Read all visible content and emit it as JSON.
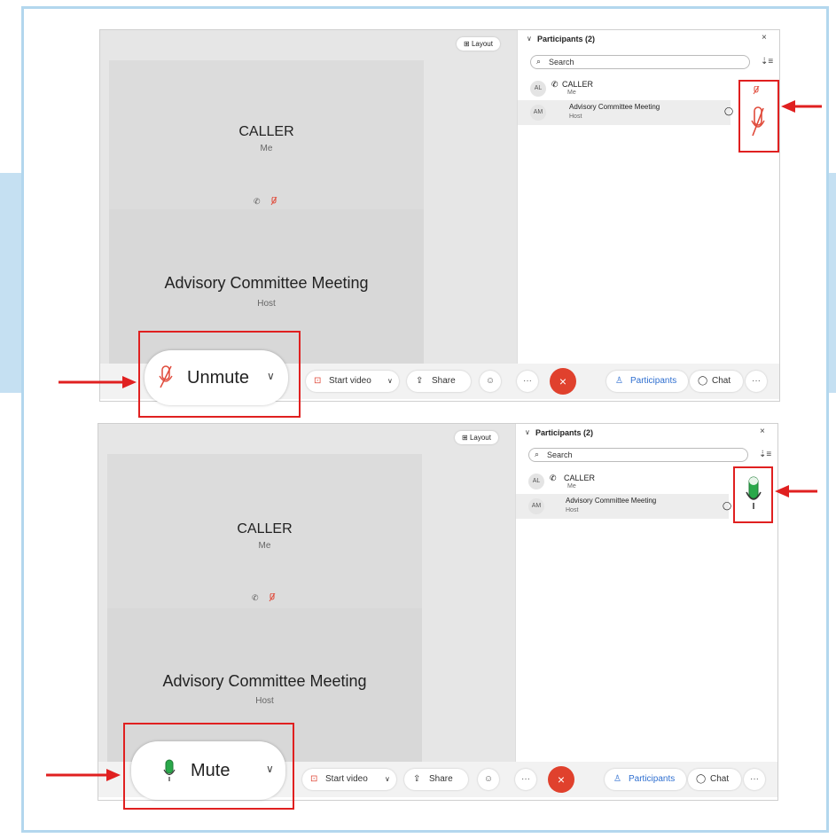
{
  "colors": {
    "frame": "#b3d7ee",
    "band": "#c5e0f2",
    "stage": "#e6e6e6",
    "tile": "#dcdcdc",
    "end_call": "#e0412d",
    "annotation": "#e02020",
    "muted_red": "#e04a3a",
    "mic_green": "#2aa84a",
    "link_blue": "#2f6fd0"
  },
  "top": {
    "layout_label": "Layout",
    "tile_caller_name": "CALLER",
    "tile_caller_sub": "Me",
    "tile_meeting_name": "Advisory Committee Meeting",
    "tile_meeting_sub": "Host",
    "panel": {
      "title": "Participants (2)",
      "close": "×",
      "search_placeholder": "Search",
      "rows": [
        {
          "initials": "AL",
          "name": "CALLER",
          "role": "Me"
        },
        {
          "initials": "AM",
          "name": "Advisory Committee Meeting",
          "role": "Host"
        }
      ]
    },
    "toolbar": {
      "mic_label": "Unmute",
      "start_video": "Start video",
      "share": "Share",
      "more": "···",
      "end": "×",
      "participants": "Participants",
      "chat": "Chat",
      "more_right": "···"
    },
    "mic_state": "muted",
    "big_mic_icon": "mic-muted-icon"
  },
  "bottom": {
    "layout_label": "Layout",
    "tile_caller_name": "CALLER",
    "tile_caller_sub": "Me",
    "tile_meeting_name": "Advisory Committee Meeting",
    "tile_meeting_sub": "Host",
    "panel": {
      "title": "Participants (2)",
      "close": "×",
      "search_placeholder": "Search",
      "rows": [
        {
          "initials": "AL",
          "name": "CALLER",
          "role": "Me"
        },
        {
          "initials": "AM",
          "name": "Advisory Committee Meeting",
          "role": "Host"
        }
      ]
    },
    "toolbar": {
      "mic_label": "Mute",
      "start_video": "Start video",
      "share": "Share",
      "more": "···",
      "end": "×",
      "participants": "Participants",
      "chat": "Chat",
      "more_right": "···"
    },
    "mic_state": "unmuted",
    "big_mic_icon": "mic-active-icon"
  }
}
